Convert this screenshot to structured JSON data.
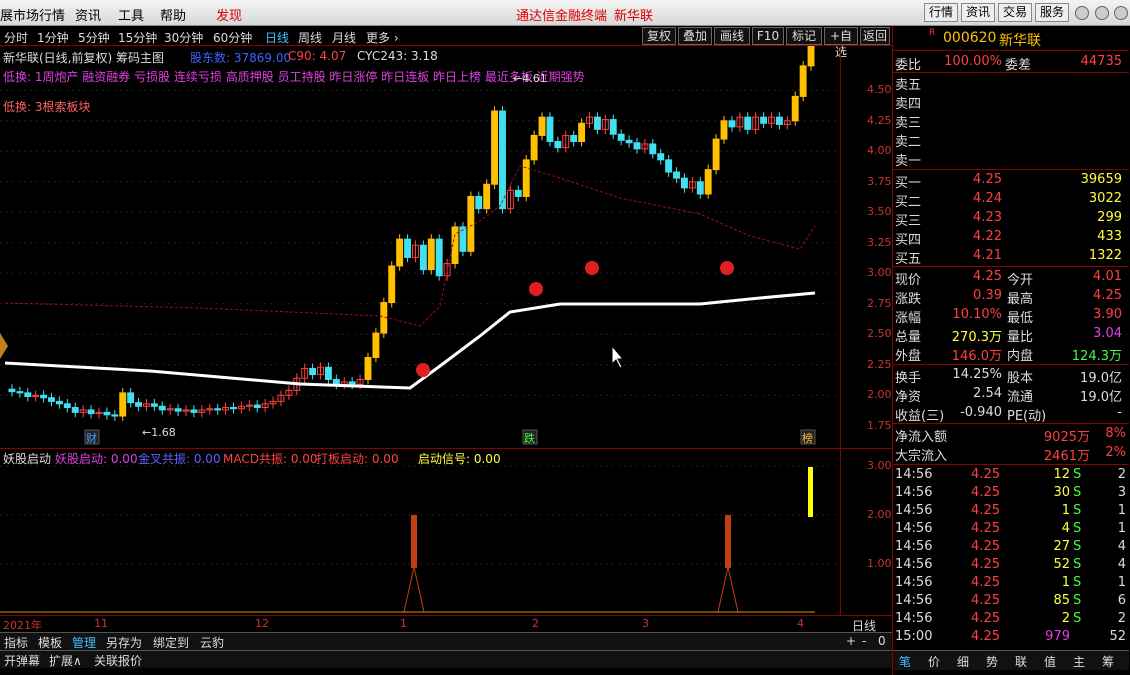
{
  "menubar": {
    "items": [
      "展市场行情",
      "资讯",
      "工具",
      "帮助",
      "发现"
    ],
    "center_text": "通达信金融终端",
    "center_stock": "新华联",
    "right_buttons": [
      "行情",
      "资讯",
      "交易",
      "服务"
    ]
  },
  "periods": [
    "分时",
    "1分钟",
    "5分钟",
    "15分钟",
    "30分钟",
    "60分钟",
    "日线",
    "周线",
    "月线",
    "更多"
  ],
  "tools": [
    "复权",
    "叠加",
    "画线",
    "F10",
    "标记",
    "+自选",
    "返回"
  ],
  "chart_header": {
    "title": "新华联(日线,前复权) 筹码主图",
    "gudong": "股东数: 37869.00",
    "c90": "C90: 4.07",
    "cyc": "CYC243: 3.18"
  },
  "info_line1": "低换: 1周炮产 融资融券 亏损股 连续亏损 高质押股 员工持股 昨日涨停 昨日连板 昨日上榜 最近多板 近期强势",
  "info_line2": "低换: 3根索板块",
  "price_axis": [
    "4.50",
    "4.25",
    "4.00",
    "3.75",
    "3.50",
    "3.25",
    "3.00",
    "2.75",
    "2.50",
    "2.25",
    "2.00",
    "1.75"
  ],
  "annotations": {
    "low": "1.68",
    "high": "4.61",
    "cai": "财",
    "die": "跌",
    "bang": "榜"
  },
  "indicator": {
    "name": "妖股启动",
    "items": [
      {
        "label": "妖股启动: 0.00",
        "color": "#e040e0"
      },
      {
        "label": "金叉共振: 0.00",
        "color": "#6060ff"
      },
      {
        "label": "MACD共振: 0.00",
        "color": "#ff4040"
      },
      {
        "label": "打板启动: 0.00",
        "color": "#ff4040"
      },
      {
        "label": "启动信号: 0.00",
        "color": "#ffff40"
      }
    ],
    "axis": [
      "3.00",
      "2.00",
      "1.00"
    ]
  },
  "date_axis": [
    "2021年",
    "11",
    "12",
    "1",
    "2",
    "3",
    "4"
  ],
  "period_label": "日线",
  "bottom_tabs": [
    "指标",
    "模板",
    "管理",
    "另存为",
    "绑定到",
    "云豹"
  ],
  "bottom_tabs2": [
    "开弹幕",
    "扩展∧",
    "关联报价"
  ],
  "zoom": [
    "+",
    "-",
    "0"
  ],
  "quote": {
    "code": "000620",
    "name": "新华联",
    "weibi_label": "委比",
    "weibi": "100.00%",
    "weicha_label": "委差",
    "weicha": "44735",
    "sells": [
      "卖五",
      "卖四",
      "卖三",
      "卖二",
      "卖一"
    ],
    "buys": [
      {
        "label": "买一",
        "price": "4.25",
        "vol": "39659"
      },
      {
        "label": "买二",
        "price": "4.24",
        "vol": "3022"
      },
      {
        "label": "买三",
        "price": "4.23",
        "vol": "299"
      },
      {
        "label": "买四",
        "price": "4.22",
        "vol": "433"
      },
      {
        "label": "买五",
        "price": "4.21",
        "vol": "1322"
      }
    ],
    "stats": [
      {
        "l1": "现价",
        "v1": "4.25",
        "c1": "#ff4040",
        "l2": "今开",
        "v2": "4.01",
        "c2": "#ff4040"
      },
      {
        "l1": "涨跌",
        "v1": "0.39",
        "c1": "#ff4040",
        "l2": "最高",
        "v2": "4.25",
        "c2": "#ff4040"
      },
      {
        "l1": "涨幅",
        "v1": "10.10%",
        "c1": "#ff4040",
        "l2": "最低",
        "v2": "3.90",
        "c2": "#ff4040"
      },
      {
        "l1": "总量",
        "v1": "270.3万",
        "c1": "#ffff40",
        "l2": "量比",
        "v2": "3.04",
        "c2": "#e040e0"
      },
      {
        "l1": "外盘",
        "v1": "146.0万",
        "c1": "#ff4040",
        "l2": "内盘",
        "v2": "124.3万",
        "c2": "#40ff40"
      },
      {
        "l1": "换手",
        "v1": "14.25%",
        "c1": "#ddd",
        "l2": "股本",
        "v2": "19.0亿",
        "c2": "#ddd"
      },
      {
        "l1": "净资",
        "v1": "2.54",
        "c1": "#ddd",
        "l2": "流通",
        "v2": "19.0亿",
        "c2": "#ddd"
      },
      {
        "l1": "收益(三)",
        "v1": "-0.940",
        "c1": "#ddd",
        "l2": "PE(动)",
        "v2": "-",
        "c2": "#ddd"
      }
    ],
    "flows": [
      {
        "label": "净流入额",
        "v": "9025万",
        "p": "8%"
      },
      {
        "label": "大宗流入",
        "v": "2461万",
        "p": "2%"
      }
    ],
    "ticks": [
      {
        "t": "14:56",
        "p": "4.25",
        "v": "12",
        "s": "S",
        "n": "2"
      },
      {
        "t": "14:56",
        "p": "4.25",
        "v": "30",
        "s": "S",
        "n": "3"
      },
      {
        "t": "14:56",
        "p": "4.25",
        "v": "1",
        "s": "S",
        "n": "1"
      },
      {
        "t": "14:56",
        "p": "4.25",
        "v": "4",
        "s": "S",
        "n": "1"
      },
      {
        "t": "14:56",
        "p": "4.25",
        "v": "27",
        "s": "S",
        "n": "4"
      },
      {
        "t": "14:56",
        "p": "4.25",
        "v": "52",
        "s": "S",
        "n": "4"
      },
      {
        "t": "14:56",
        "p": "4.25",
        "v": "1",
        "s": "S",
        "n": "1"
      },
      {
        "t": "14:56",
        "p": "4.25",
        "v": "85",
        "s": "S",
        "n": "6"
      },
      {
        "t": "14:56",
        "p": "4.25",
        "v": "2",
        "s": "S",
        "n": "2"
      },
      {
        "t": "15:00",
        "p": "4.25",
        "v": "979",
        "s": "",
        "n": "52"
      }
    ],
    "bottom_tabs": [
      "笔",
      "价",
      "细",
      "势",
      "联",
      "值",
      "主",
      "筹"
    ]
  }
}
